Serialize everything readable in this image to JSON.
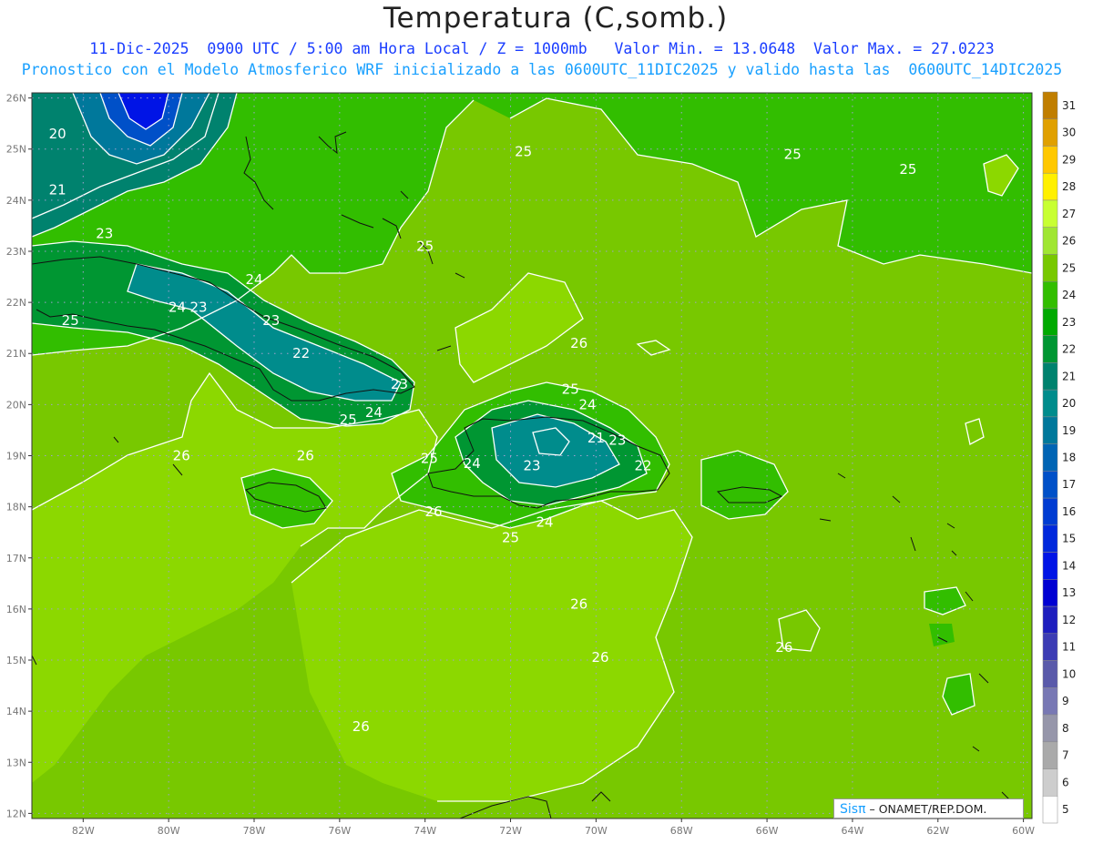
{
  "header": {
    "title": "Temperatura (C,somb.)",
    "line1": "11-Dic-2025  0900 UTC / 5:00 am Hora Local / Z = 1000mb   Valor Min. = 13.0648  Valor Max. = 27.0223",
    "line2": "Pronostico con el Modelo Atmosferico WRF inicializado a las 0600UTC_11DIC2025 y valido hasta las  0600UTC_14DIC2025"
  },
  "credit": {
    "sis": "Sisπ",
    "text": " – ONAMET/REP.DOM."
  },
  "axes": {
    "lat_labels": [
      "26N",
      "25N",
      "24N",
      "23N",
      "22N",
      "21N",
      "20N",
      "19N",
      "18N",
      "17N",
      "16N",
      "15N",
      "14N",
      "13N",
      "12N"
    ],
    "lon_labels": [
      "82W",
      "80W",
      "78W",
      "76W",
      "74W",
      "72W",
      "70W",
      "68W",
      "66W",
      "64W",
      "62W",
      "60W"
    ]
  },
  "colorbar": {
    "labels": [
      "31",
      "30",
      "29",
      "28",
      "27",
      "26",
      "25",
      "24",
      "23",
      "22",
      "21",
      "20",
      "19",
      "18",
      "17",
      "16",
      "15",
      "14",
      "13",
      "12",
      "11",
      "10",
      "9",
      "8",
      "7",
      "6",
      "5"
    ],
    "colors": [
      "#c07e00",
      "#e0a000",
      "#ffc800",
      "#fff000",
      "#c8ff32",
      "#a0e632",
      "#78c800",
      "#32be00",
      "#00aa00",
      "#009632",
      "#00826e",
      "#008c8c",
      "#00789b",
      "#0064b4",
      "#0050c8",
      "#003cd2",
      "#0028dc",
      "#0014e6",
      "#0000d2",
      "#1e1ebe",
      "#3c3cb4",
      "#5a5aaa",
      "#7878b4",
      "#9696aa",
      "#aaaaaa",
      "#cdcdcd",
      "#ffffff"
    ]
  },
  "contour_labels": [
    {
      "t": "20",
      "lon": -82.6,
      "lat": 25.3
    },
    {
      "t": "21",
      "lon": -82.6,
      "lat": 24.2
    },
    {
      "t": "23",
      "lon": -81.5,
      "lat": 23.35
    },
    {
      "t": "25",
      "lon": -82.3,
      "lat": 21.65
    },
    {
      "t": "24",
      "lon": -79.8,
      "lat": 21.9
    },
    {
      "t": "23",
      "lon": -79.3,
      "lat": 21.9
    },
    {
      "t": "24",
      "lon": -78.0,
      "lat": 22.45
    },
    {
      "t": "23",
      "lon": -77.6,
      "lat": 21.65
    },
    {
      "t": "22",
      "lon": -76.9,
      "lat": 21.0
    },
    {
      "t": "23",
      "lon": -74.6,
      "lat": 20.4
    },
    {
      "t": "25",
      "lon": -75.8,
      "lat": 19.7
    },
    {
      "t": "24",
      "lon": -75.2,
      "lat": 19.85
    },
    {
      "t": "25",
      "lon": -74.0,
      "lat": 23.1
    },
    {
      "t": "25",
      "lon": -71.7,
      "lat": 24.95
    },
    {
      "t": "25",
      "lon": -65.4,
      "lat": 24.9
    },
    {
      "t": "25",
      "lon": -62.7,
      "lat": 24.6
    },
    {
      "t": "26",
      "lon": -70.4,
      "lat": 21.2
    },
    {
      "t": "25",
      "lon": -70.6,
      "lat": 20.3
    },
    {
      "t": "24",
      "lon": -70.2,
      "lat": 20.0
    },
    {
      "t": "21",
      "lon": -70.0,
      "lat": 19.35
    },
    {
      "t": "23",
      "lon": -69.5,
      "lat": 19.3
    },
    {
      "t": "22",
      "lon": -68.9,
      "lat": 18.8
    },
    {
      "t": "23",
      "lon": -71.5,
      "lat": 18.8
    },
    {
      "t": "24",
      "lon": -72.9,
      "lat": 18.85
    },
    {
      "t": "25",
      "lon": -73.9,
      "lat": 18.95
    },
    {
      "t": "26",
      "lon": -73.8,
      "lat": 17.9
    },
    {
      "t": "25",
      "lon": -72.0,
      "lat": 17.4
    },
    {
      "t": "24",
      "lon": -71.2,
      "lat": 17.7
    },
    {
      "t": "26",
      "lon": -79.7,
      "lat": 19.0
    },
    {
      "t": "26",
      "lon": -76.8,
      "lat": 19.0
    },
    {
      "t": "26",
      "lon": -70.4,
      "lat": 16.1
    },
    {
      "t": "26",
      "lon": -69.9,
      "lat": 15.05
    },
    {
      "t": "26",
      "lon": -65.6,
      "lat": 15.25
    },
    {
      "t": "26",
      "lon": -75.5,
      "lat": 13.7
    }
  ]
}
